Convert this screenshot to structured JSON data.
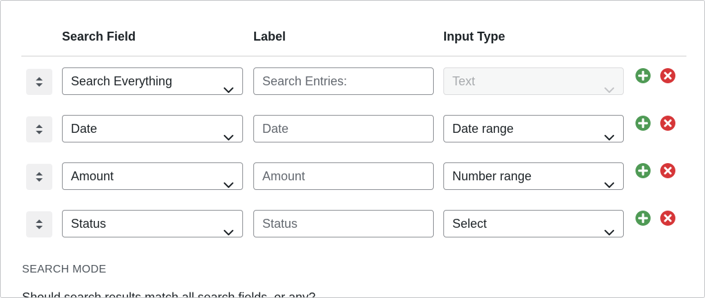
{
  "headers": {
    "search_field": "Search Field",
    "label": "Label",
    "input_type": "Input Type"
  },
  "rows": [
    {
      "field": "Search Everything",
      "label_placeholder": "Search Entries:",
      "input_type": "Text",
      "input_type_disabled": true
    },
    {
      "field": "Date",
      "label_placeholder": "Date",
      "input_type": "Date range",
      "input_type_disabled": false
    },
    {
      "field": "Amount",
      "label_placeholder": "Amount",
      "input_type": "Number range",
      "input_type_disabled": false
    },
    {
      "field": "Status",
      "label_placeholder": "Status",
      "input_type": "Select",
      "input_type_disabled": false
    }
  ],
  "search_mode": {
    "title": "SEARCH MODE",
    "description": "Should search results match all search fields, or any?"
  },
  "icons": {
    "drag": "sort-handle-icon",
    "add": "plus-circle-icon",
    "remove": "x-circle-icon",
    "dropdown": "chevron-down-icon"
  },
  "colors": {
    "add": "#4f9a55",
    "remove": "#d63638",
    "border": "#8c8f94",
    "disabled_text": "#a7aaad"
  }
}
